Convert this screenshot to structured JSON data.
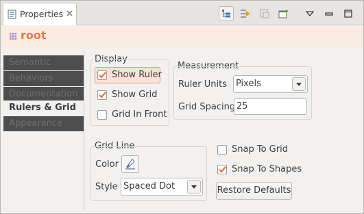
{
  "tab": {
    "title": "Properties",
    "icon": "properties-icon",
    "close_icon": "close-icon"
  },
  "toolbar": {
    "buttons": [
      {
        "name": "categories-toggle",
        "icon": "tree-categories-icon",
        "active": true
      },
      {
        "name": "filter-advanced",
        "icon": "advanced-filter-icon",
        "active": false
      },
      {
        "name": "pin-view",
        "icon": "pin-icon",
        "active": false
      },
      {
        "name": "new-view",
        "icon": "new-properties-view-icon",
        "active": false
      },
      {
        "name": "view-menu",
        "icon": "view-menu-icon",
        "active": false
      },
      {
        "name": "minimize",
        "icon": "minimize-icon",
        "active": false
      },
      {
        "name": "maximize",
        "icon": "maximize-icon",
        "active": false
      }
    ]
  },
  "header": {
    "title": "root",
    "icon": "root-element-icon",
    "accent_color": "#e47a46"
  },
  "sidebar": {
    "items": [
      {
        "label": "Semantic",
        "selected": false
      },
      {
        "label": "Behaviors",
        "selected": false
      },
      {
        "label": "Documentation",
        "selected": false
      },
      {
        "label": "Rulers & Grid",
        "selected": true
      },
      {
        "label": "Appearance",
        "selected": false
      }
    ]
  },
  "display": {
    "title": "Display",
    "show_ruler": {
      "label": "Show Ruler",
      "checked": true
    },
    "show_grid": {
      "label": "Show Grid",
      "checked": true
    },
    "grid_in_front": {
      "label": "Grid In Front",
      "checked": false
    }
  },
  "measurement": {
    "title": "Measurement",
    "ruler_units_label": "Ruler Units",
    "ruler_units_value": "Pixels",
    "grid_spacing_label": "Grid Spacing",
    "grid_spacing_value": "25"
  },
  "grid_line": {
    "title": "Grid Line",
    "color_label": "Color",
    "color_icon": "paint-brush-icon",
    "style_label": "Style",
    "style_value": "Spaced Dot"
  },
  "snap": {
    "snap_to_grid": {
      "label": "Snap To Grid",
      "checked": false
    },
    "snap_to_shapes": {
      "label": "Snap To Shapes",
      "checked": true
    }
  },
  "restore_defaults_label": "Restore Defaults",
  "colors": {
    "check_mark": "#e47a46",
    "focus_border": "#e9957a",
    "header_bg": "#fbece3"
  }
}
